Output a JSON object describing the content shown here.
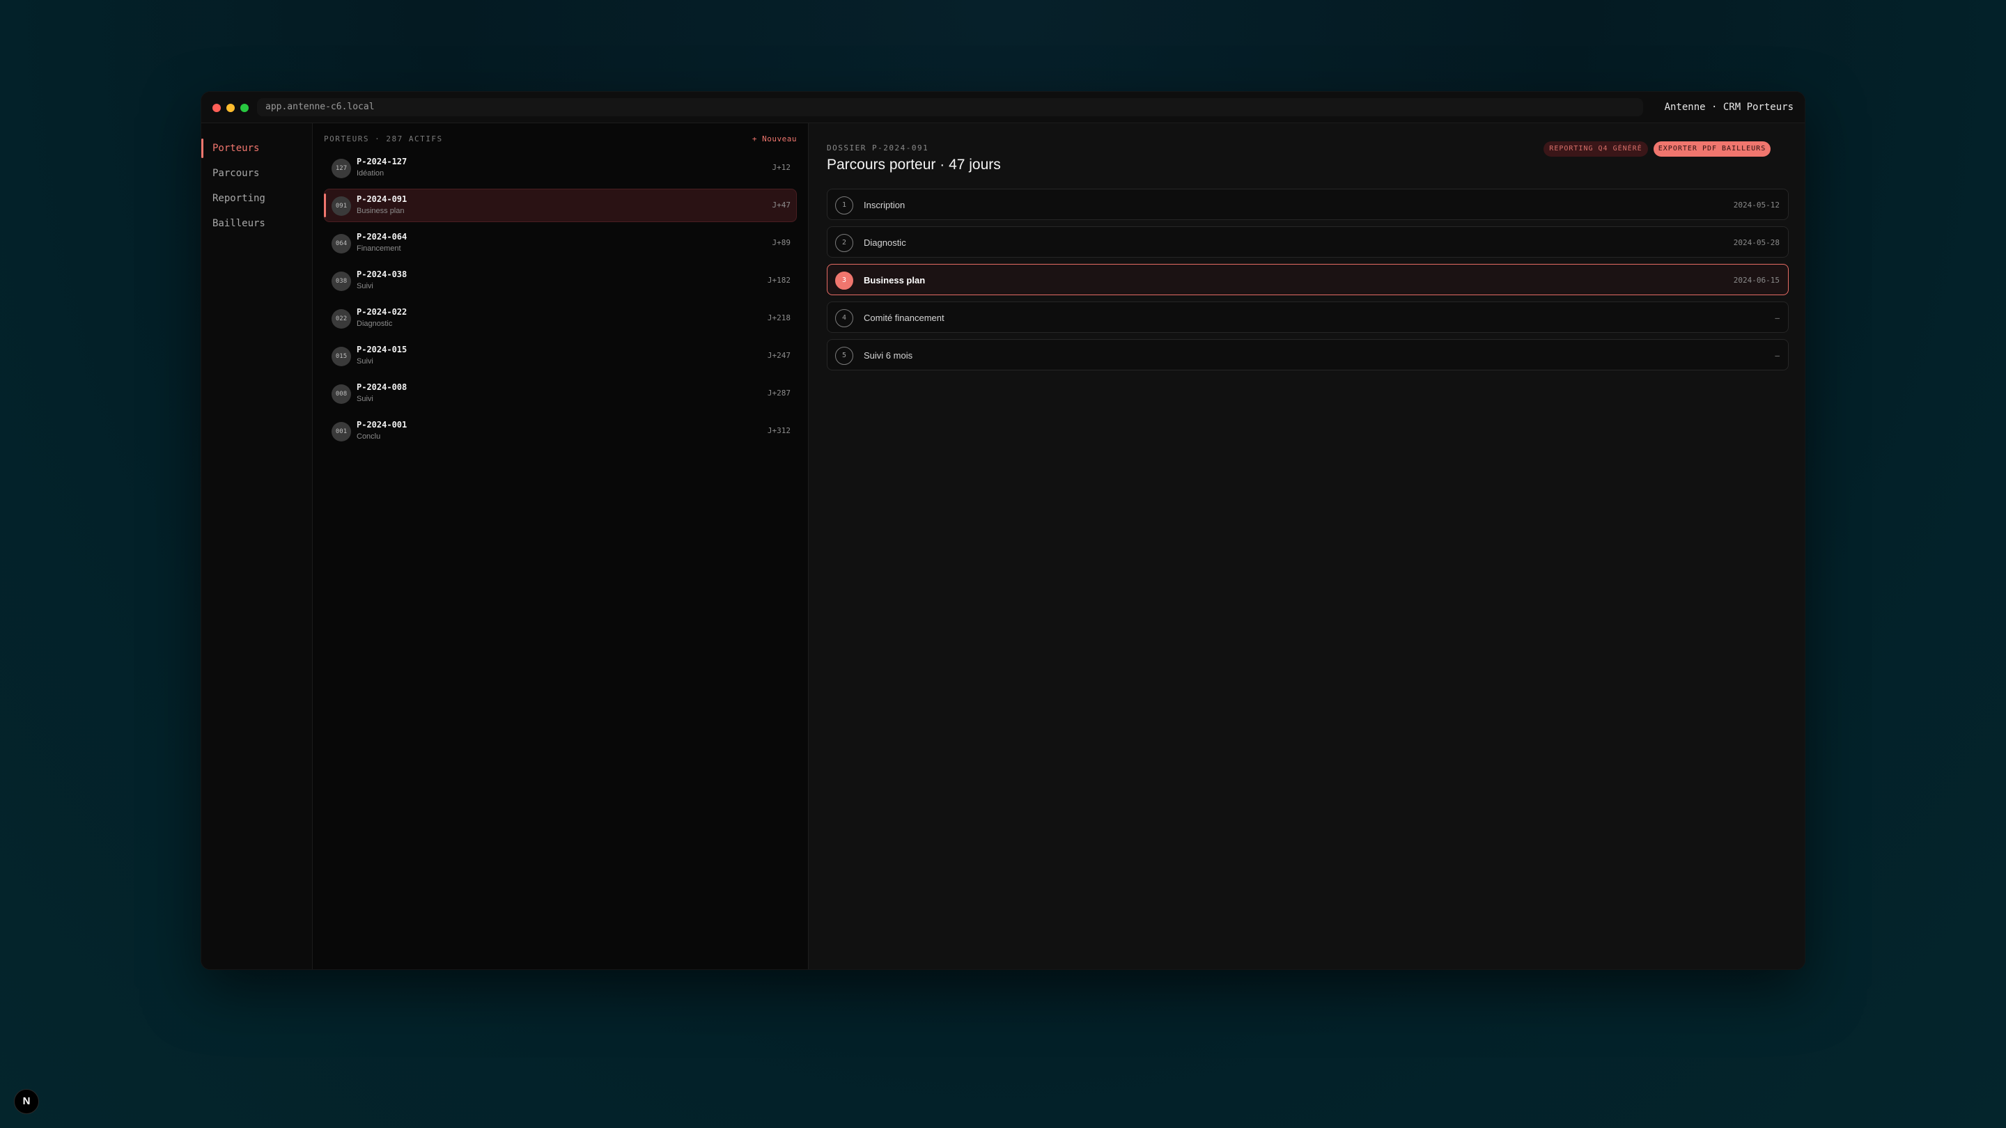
{
  "browser": {
    "url": "app.antenne-c6.local",
    "app_title": "Antenne · CRM Porteurs"
  },
  "sidebar": {
    "items": [
      {
        "label": "Porteurs",
        "active": true
      },
      {
        "label": "Parcours",
        "active": false
      },
      {
        "label": "Reporting",
        "active": false
      },
      {
        "label": "Bailleurs",
        "active": false
      }
    ]
  },
  "list": {
    "header": "PORTEURS · 287 ACTIFS",
    "new_label": "+ Nouveau",
    "rows": [
      {
        "avatar": "127",
        "id": "P-2024-127",
        "stage": "Idéation",
        "day": "J+12"
      },
      {
        "avatar": "091",
        "id": "P-2024-091",
        "stage": "Business plan",
        "day": "J+47"
      },
      {
        "avatar": "064",
        "id": "P-2024-064",
        "stage": "Financement",
        "day": "J+89"
      },
      {
        "avatar": "038",
        "id": "P-2024-038",
        "stage": "Suivi",
        "day": "J+182"
      },
      {
        "avatar": "022",
        "id": "P-2024-022",
        "stage": "Diagnostic",
        "day": "J+218"
      },
      {
        "avatar": "015",
        "id": "P-2024-015",
        "stage": "Suivi",
        "day": "J+247"
      },
      {
        "avatar": "008",
        "id": "P-2024-008",
        "stage": "Suivi",
        "day": "J+287"
      },
      {
        "avatar": "001",
        "id": "P-2024-001",
        "stage": "Conclu",
        "day": "J+312"
      }
    ]
  },
  "detail": {
    "dossier": "DOSSIER P-2024-091",
    "title": "Parcours porteur · 47 jours",
    "badge": "REPORTING Q4 GÉNÉRÉ",
    "export_label": "EXPORTER PDF BAILLEURS",
    "steps": [
      {
        "num": "1",
        "label": "Inscription",
        "date": "2024-05-12"
      },
      {
        "num": "2",
        "label": "Diagnostic",
        "date": "2024-05-28"
      },
      {
        "num": "3",
        "label": "Business plan",
        "date": "2024-06-15"
      },
      {
        "num": "4",
        "label": "Comité financement",
        "date": "—"
      },
      {
        "num": "5",
        "label": "Suivi 6 mois",
        "date": "—"
      }
    ]
  },
  "corner_badge": "N",
  "colors": {
    "accent": "#f0766e",
    "background": "#041d25"
  }
}
